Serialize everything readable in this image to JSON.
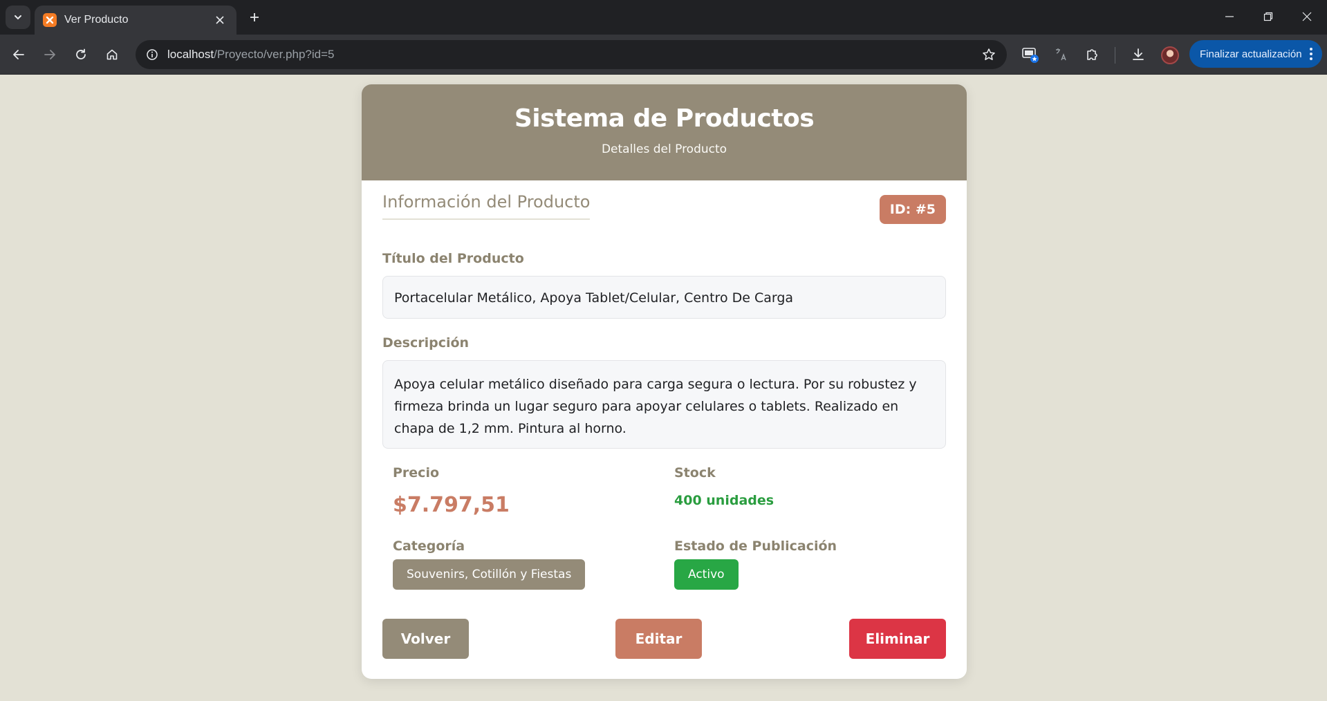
{
  "browser": {
    "tab_title": "Ver Producto",
    "url_host": "localhost",
    "url_path": "/Proyecto/ver.php?id=5",
    "update_button": "Finalizar actualización"
  },
  "colors": {
    "header_bg": "#948b78",
    "accent": "#c97c64",
    "success": "#28a745",
    "danger": "#dc3545",
    "page_bg": "#e3e1d5"
  },
  "header": {
    "title": "Sistema de Productos",
    "subtitle": "Detalles del Producto"
  },
  "product": {
    "section_title": "Información del Producto",
    "id_badge": "ID: #5",
    "title_label": "Título del Producto",
    "title_value": "Portacelular Metálico, Apoya Tablet/Celular, Centro De Carga",
    "description_label": "Descripción",
    "description_value": "Apoya celular metálico diseñado para carga segura o lectura. Por su robustez y firmeza brinda un lugar seguro para apoyar celulares o tablets. Realizado en chapa de 1,2 mm. Pintura al horno.",
    "price_label": "Precio",
    "price_value": "$7.797,51",
    "stock_label": "Stock",
    "stock_value": "400 unidades",
    "category_label": "Categoría",
    "category_value": "Souvenirs, Cotillón y Fiestas",
    "status_label": "Estado de Publicación",
    "status_value": "Activo"
  },
  "actions": {
    "back": "Volver",
    "edit": "Editar",
    "delete": "Eliminar"
  }
}
